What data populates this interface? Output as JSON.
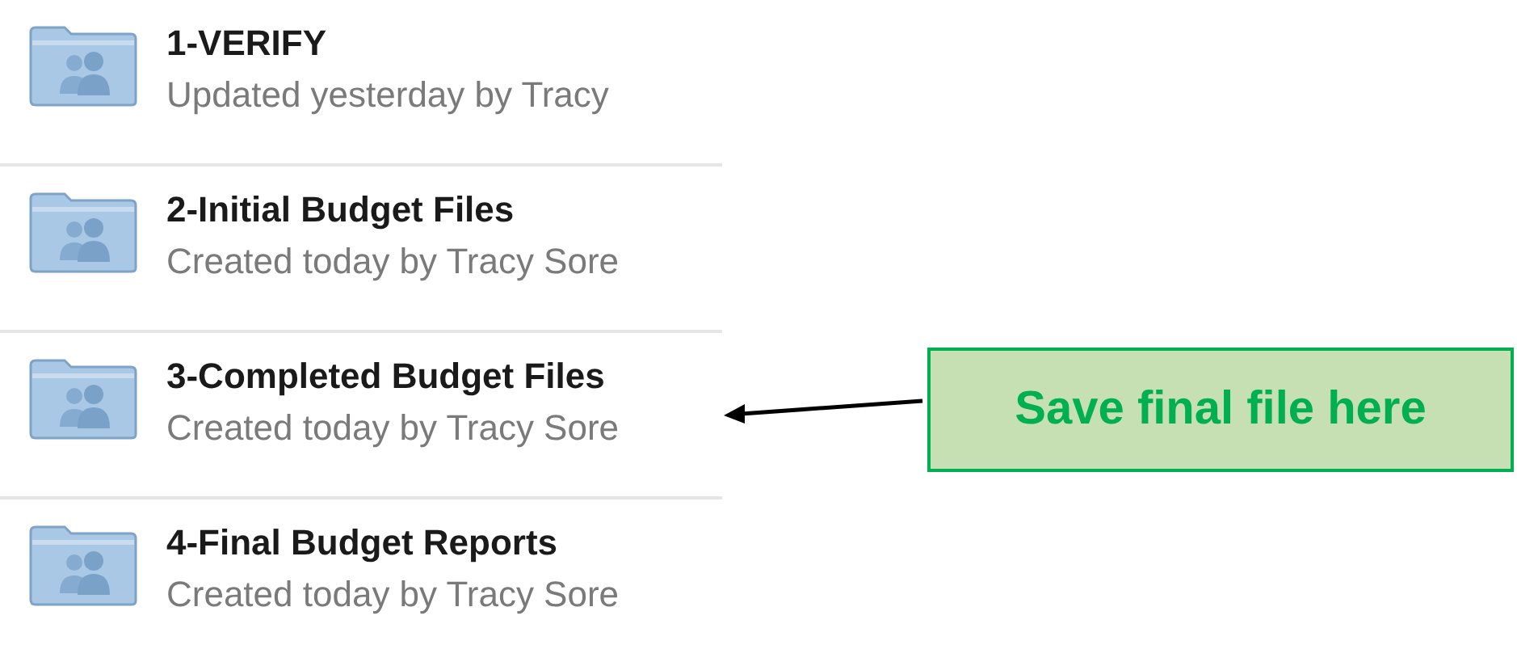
{
  "folders": [
    {
      "name": "1-VERIFY",
      "detail": "Updated yesterday by Tracy"
    },
    {
      "name": "2-Initial Budget Files",
      "detail": "Created today by Tracy Sore"
    },
    {
      "name": "3-Completed Budget Files",
      "detail": "Created today by Tracy Sore"
    },
    {
      "name": "4-Final Budget Reports",
      "detail": "Created today by Tracy Sore"
    }
  ],
  "callout": {
    "text": "Save final file here"
  }
}
